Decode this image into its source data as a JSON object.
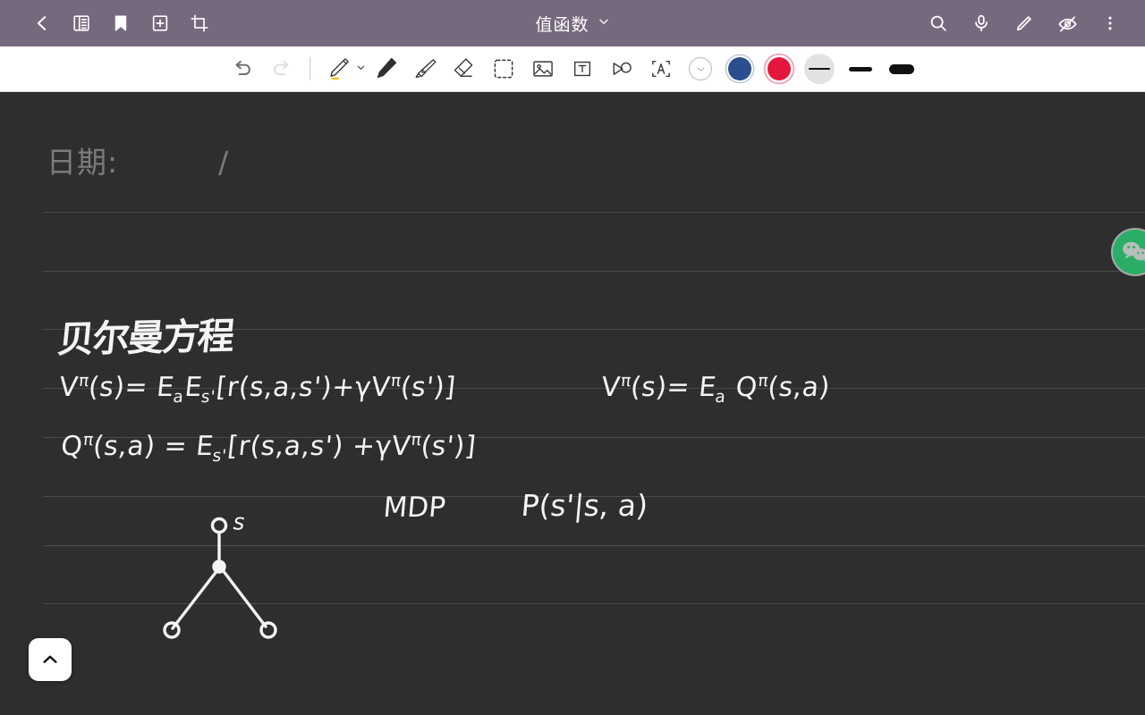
{
  "header": {
    "title": "值函数",
    "left_icons": [
      {
        "name": "back-icon",
        "label": "Back"
      },
      {
        "name": "page-list-icon",
        "label": "Page list"
      },
      {
        "name": "bookmark-icon",
        "label": "Bookmark"
      },
      {
        "name": "add-page-icon",
        "label": "Add page"
      },
      {
        "name": "crop-icon",
        "label": "Crop"
      }
    ],
    "right_icons": [
      {
        "name": "search-icon",
        "label": "Search"
      },
      {
        "name": "microphone-icon",
        "label": "Record audio"
      },
      {
        "name": "edit-pen-icon",
        "label": "Edit"
      },
      {
        "name": "eye-off-icon",
        "label": "Hide annotations"
      },
      {
        "name": "more-vertical-icon",
        "label": "More options"
      }
    ],
    "dropdown_icon": "chevron-down-icon",
    "background_color": "#76697e"
  },
  "toolbar": {
    "undo": {
      "name": "undo-icon",
      "label": "Undo",
      "enabled": true
    },
    "redo": {
      "name": "redo-icon",
      "label": "Redo",
      "enabled": false
    },
    "tools": [
      {
        "name": "pencil-tool",
        "label": "Pencil",
        "selected": true,
        "accent": "#f2c230"
      },
      {
        "name": "pen-tool",
        "label": "Pen",
        "selected": false
      },
      {
        "name": "highlighter-tool",
        "label": "Highlighter",
        "selected": false
      },
      {
        "name": "eraser-tool",
        "label": "Eraser",
        "selected": false
      },
      {
        "name": "lasso-select-tool",
        "label": "Select",
        "selected": false
      },
      {
        "name": "insert-image-tool",
        "label": "Insert image",
        "selected": false
      },
      {
        "name": "text-box-tool",
        "label": "Text box",
        "selected": false
      },
      {
        "name": "shape-tool",
        "label": "Shape",
        "selected": false
      },
      {
        "name": "handwriting-recognition-tool",
        "label": "Convert handwriting",
        "selected": false
      }
    ],
    "colors": [
      {
        "name": "color-swatch-more",
        "label": "More colors",
        "hex": "#ffffff",
        "selected": false
      },
      {
        "name": "color-swatch-navy",
        "label": "Navy blue",
        "hex": "#2b4f8e",
        "selected": false
      },
      {
        "name": "color-swatch-red",
        "label": "Red",
        "hex": "#e5173f",
        "selected": true
      }
    ],
    "stroke_widths": [
      {
        "name": "stroke-width-thin",
        "label": "Thin",
        "px": 3,
        "selected": true
      },
      {
        "name": "stroke-width-medium",
        "label": "Medium",
        "px": 6,
        "selected": false
      },
      {
        "name": "stroke-width-thick",
        "label": "Thick",
        "px": 12,
        "selected": false
      }
    ],
    "background_color": "#ffffff"
  },
  "canvas": {
    "background_color": "#2e2e2e",
    "rule_color": "#4a4a4a",
    "rule_positions": [
      134,
      200,
      265,
      331,
      386,
      452,
      507,
      572
    ],
    "date_label": "日期:",
    "date_separator": "/",
    "notes": {
      "title": "贝尔曼方程",
      "equations": [
        {
          "id": "value-function-expansion",
          "text": "Vπ(s) = Ea Es' [ r(s,a,s') + γ Vπ(s') ]"
        },
        {
          "id": "value-from-q",
          "text": "Vπ(s) = Ea Qπ(s,a)"
        },
        {
          "id": "q-function-expansion",
          "text": "Qπ(s,a) = Es' [ r(s,a,s') + γ Vπ(s') ]"
        }
      ],
      "mdp_label": "MDP",
      "transition_label": "P(s'|s, a)",
      "tree_node_label": "s"
    }
  },
  "floating": {
    "wechat": {
      "name": "wechat-float-icon",
      "label": "WeChat",
      "color": "#2aae67"
    },
    "scroll_up": {
      "name": "scroll-up-button",
      "icon": "chevron-up-icon",
      "label": "Scroll to top"
    }
  }
}
